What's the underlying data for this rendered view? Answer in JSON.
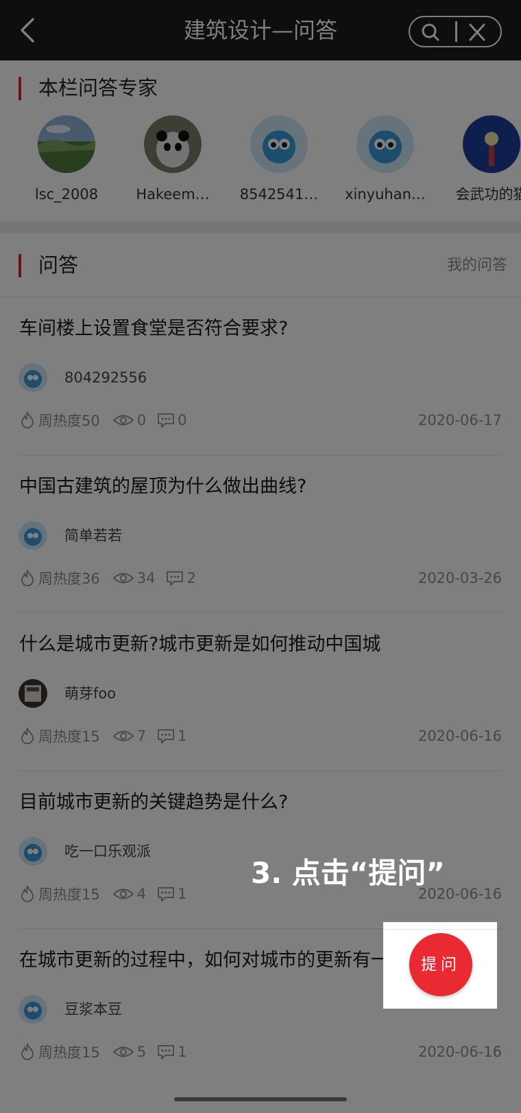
{
  "header": {
    "title": "建筑设计—问答"
  },
  "experts_section": {
    "title": "本栏问答专家"
  },
  "experts": [
    {
      "name": "lsc_2008"
    },
    {
      "name": "Hakeem…"
    },
    {
      "name": "8542541…"
    },
    {
      "name": "xinyuhan…"
    },
    {
      "name": "会武功的猫"
    }
  ],
  "qa_section": {
    "title": "问答",
    "my_link": "我的问答"
  },
  "questions": [
    {
      "title": "车间楼上设置食堂是否符合要求?",
      "user": "804292556",
      "heat": "周热度50",
      "views": "0",
      "comments": "0",
      "date": "2020-06-17"
    },
    {
      "title": "中国古建筑的屋顶为什么做出曲线?",
      "user": "简单若若",
      "heat": "周热度36",
      "views": "34",
      "comments": "2",
      "date": "2020-03-26"
    },
    {
      "title": "什么是城市更新?城市更新是如何推动中国城",
      "user": "萌芽foo",
      "heat": "周热度15",
      "views": "7",
      "comments": "1",
      "date": "2020-06-16"
    },
    {
      "title": "目前城市更新的关键趋势是什么?",
      "user": "吃一口乐观派",
      "heat": "周热度15",
      "views": "4",
      "comments": "1",
      "date": "2020-06-16"
    },
    {
      "title": "在城市更新的过程中，如何对城市的更新有一",
      "user": "豆浆本豆",
      "heat": "周热度15",
      "views": "5",
      "comments": "1",
      "date": "2020-06-16"
    }
  ],
  "instruction": "3. 点击“提问”",
  "ask_button": {
    "label": "提问"
  },
  "colors": {
    "accent": "#e5222a",
    "header_bg": "#1c1c1c",
    "ask_bg": "#ea2a33"
  }
}
